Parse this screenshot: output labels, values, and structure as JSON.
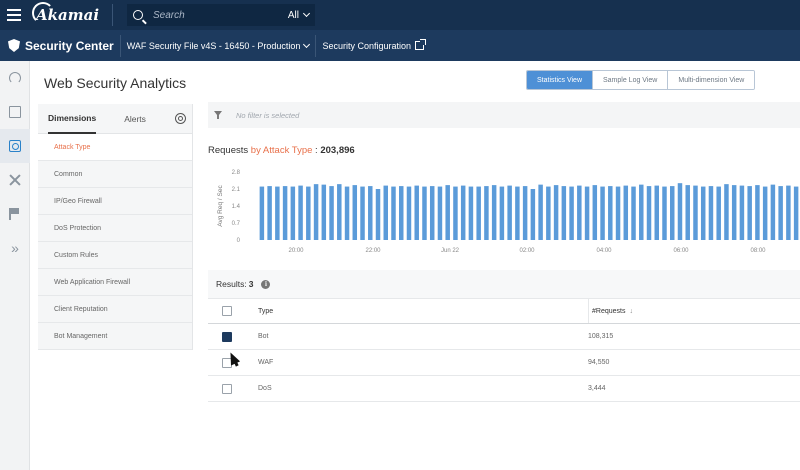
{
  "topbar": {
    "logo": "Akamai",
    "search_placeholder": "Search",
    "search_scope": "All"
  },
  "subbar": {
    "product": "Security Center",
    "config": "WAF Security File v4S - 16450 - Production",
    "link": "Security Configuration"
  },
  "page": {
    "title": "Web Security Analytics",
    "views": [
      "Statistics View",
      "Sample Log View",
      "Multi-dimension View"
    ],
    "active_view": 0
  },
  "sidebar": {
    "tabs": [
      "Dimensions",
      "Alerts"
    ],
    "items": [
      {
        "label": "Attack Type",
        "active": true
      },
      {
        "label": "Common"
      },
      {
        "label": "IP/Geo Firewall"
      },
      {
        "label": "DoS Protection"
      },
      {
        "label": "Custom Rules"
      },
      {
        "label": "Web Application Firewall"
      },
      {
        "label": "Client Reputation"
      },
      {
        "label": "Bot Management"
      }
    ]
  },
  "filter": {
    "placeholder": "No filter is selected"
  },
  "chart_header": {
    "prefix": "Requests",
    "by": "by Attack Type",
    "sep": " : ",
    "total": "203,896"
  },
  "chart_data": {
    "type": "bar",
    "ylabel": "Avg Req / Sec",
    "yticks": [
      "2.8",
      "2.1",
      "1.4",
      "0.7",
      "0"
    ],
    "ylim": [
      0,
      2.8
    ],
    "xticks": [
      "20:00",
      "22:00",
      "Jun 22",
      "02:00",
      "04:00",
      "06:00",
      "08:00"
    ],
    "values": [
      2.2,
      2.22,
      2.2,
      2.22,
      2.2,
      2.24,
      2.2,
      2.3,
      2.28,
      2.22,
      2.3,
      2.2,
      2.26,
      2.2,
      2.22,
      2.1,
      2.24,
      2.2,
      2.22,
      2.2,
      2.24,
      2.2,
      2.22,
      2.2,
      2.26,
      2.2,
      2.24,
      2.2,
      2.2,
      2.22,
      2.26,
      2.2,
      2.24,
      2.2,
      2.22,
      2.1,
      2.28,
      2.2,
      2.26,
      2.22,
      2.2,
      2.24,
      2.2,
      2.26,
      2.2,
      2.22,
      2.2,
      2.24,
      2.2,
      2.28,
      2.22,
      2.24,
      2.2,
      2.22,
      2.34,
      2.26,
      2.24,
      2.2,
      2.22,
      2.2,
      2.3,
      2.26,
      2.24,
      2.22,
      2.26,
      2.2,
      2.28,
      2.22,
      2.24,
      2.2
    ],
    "color": "#5b9bd9"
  },
  "results": {
    "label": "Results:",
    "count": "3",
    "columns": {
      "type": "Type",
      "requests": "#Requests"
    },
    "rows": [
      {
        "type": "Bot",
        "requests": "108,315",
        "checked": true
      },
      {
        "type": "WAF",
        "requests": "94,550",
        "checked": false
      },
      {
        "type": "DoS",
        "requests": "3,444",
        "checked": false
      }
    ]
  }
}
